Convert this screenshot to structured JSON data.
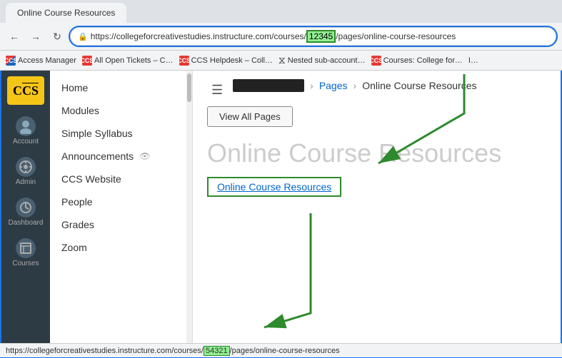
{
  "browser": {
    "url": "https://collegeforcreativestudies.instructure.com/courses/12345/pages/online-course-resources",
    "url_highlight": "12345",
    "tab_label": "Online Course Resources"
  },
  "bookmarks": [
    {
      "label": "Access Manager",
      "icon_color": "stripe",
      "id": "bm-access-manager"
    },
    {
      "label": "All Open Tickets – C…",
      "icon_color": "red",
      "id": "bm-tickets"
    },
    {
      "label": "CCS Helpdesk – Coll…",
      "icon_color": "red",
      "id": "bm-helpdesk"
    },
    {
      "label": "Nested sub-account…",
      "icon_color": "stripe",
      "id": "bm-nested"
    },
    {
      "label": "Courses: College for…",
      "icon_color": "red",
      "id": "bm-courses"
    }
  ],
  "global_nav": {
    "logo_text": "CCS",
    "items": [
      {
        "label": "Account",
        "icon": "👤",
        "id": "nav-account"
      },
      {
        "label": "Admin",
        "icon": "🔗",
        "id": "nav-admin"
      },
      {
        "label": "Dashboard",
        "icon": "⊙",
        "id": "nav-dashboard"
      },
      {
        "label": "Courses",
        "icon": "📋",
        "id": "nav-courses"
      }
    ]
  },
  "course_nav": {
    "items": [
      {
        "label": "Home",
        "id": "cnav-home"
      },
      {
        "label": "Modules",
        "id": "cnav-modules"
      },
      {
        "label": "Simple Syllabus",
        "id": "cnav-syllabus"
      },
      {
        "label": "Announcements",
        "id": "cnav-announcements",
        "has_eye": true
      },
      {
        "label": "CCS Website",
        "id": "cnav-website"
      },
      {
        "label": "People",
        "id": "cnav-people"
      },
      {
        "label": "Grades",
        "id": "cnav-grades"
      },
      {
        "label": "Zoom",
        "id": "cnav-zoom"
      }
    ]
  },
  "page": {
    "breadcrumb_pages": "Pages",
    "breadcrumb_current": "Online Course Resources",
    "view_all_btn": "View All Pages",
    "title": "Online Course Resources",
    "link_text": "Online Course Resources"
  },
  "status_bar": {
    "url": "https://collegeforcreativestudies.instructure.com/courses/54321/pages/online-course-resources",
    "url_highlight": "54321"
  }
}
